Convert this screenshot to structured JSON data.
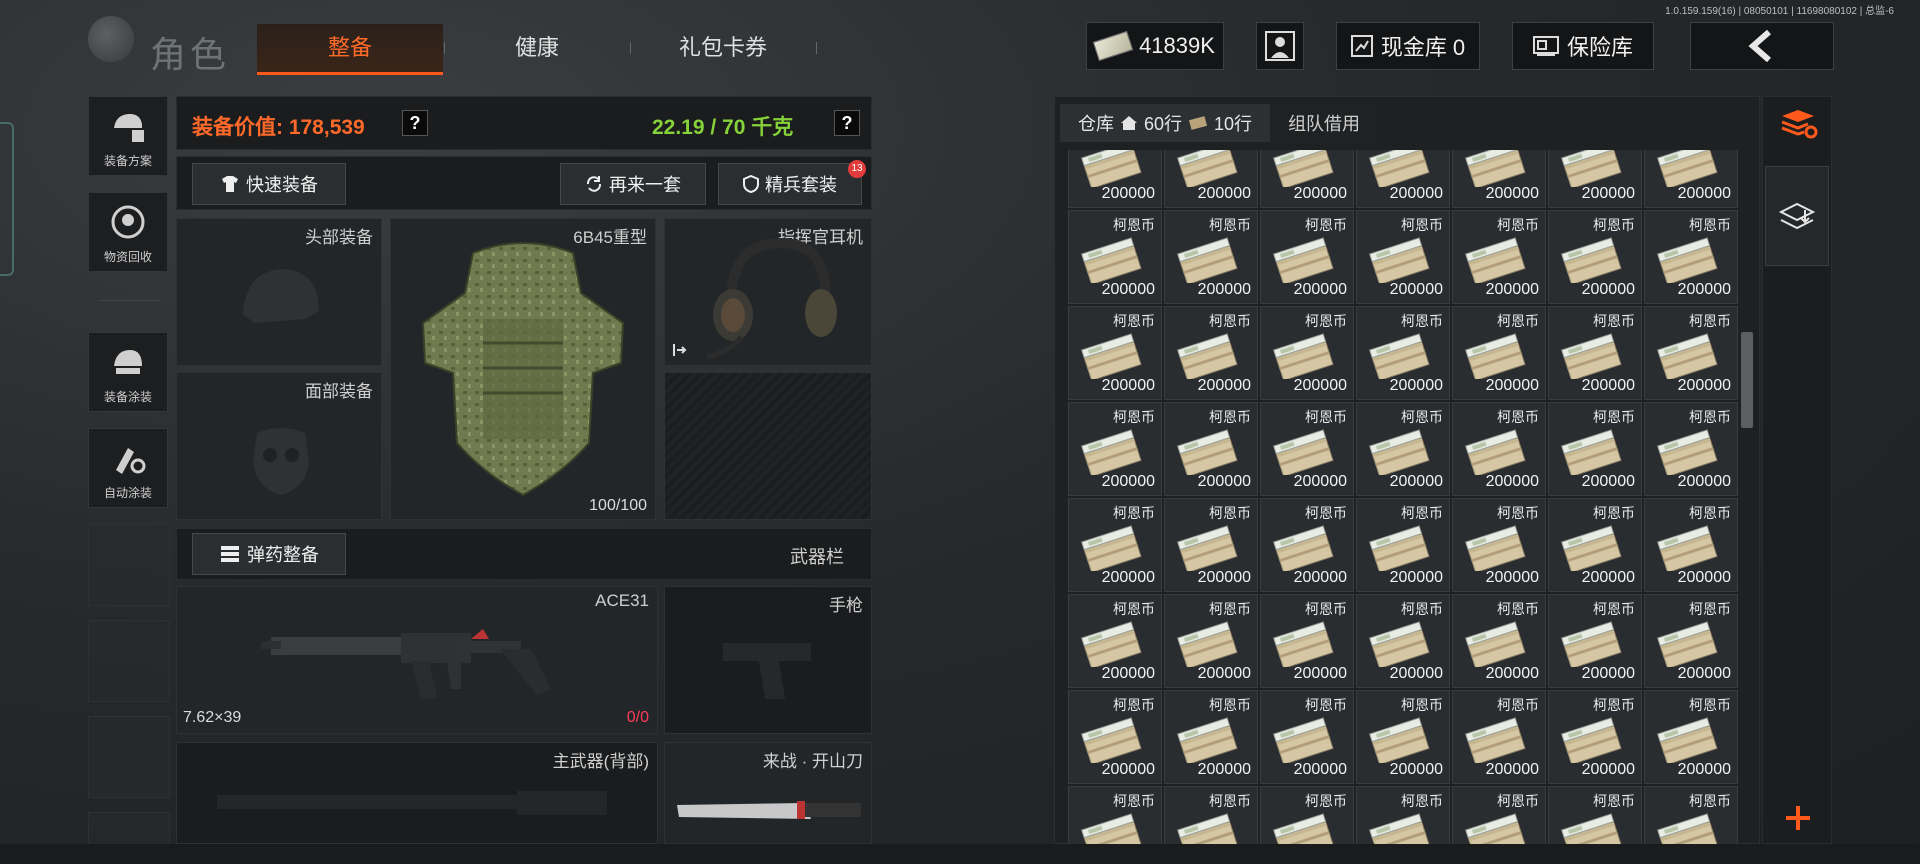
{
  "version": "1.0.159.159(16) | 08050101 | 11698080102 | 总监-6",
  "header": {
    "section_title": "角色",
    "tabs": [
      {
        "label": "整备",
        "active": true
      },
      {
        "label": "健康",
        "active": false
      },
      {
        "label": "礼包卡券",
        "active": false
      }
    ],
    "currency": "41839K",
    "cash_vault": "现金库 0",
    "safe_vault": "保险库",
    "back_icon": "chevron-left-icon"
  },
  "sidebar": {
    "items": [
      {
        "label": "装备方案",
        "icon": "loadout-plan-icon"
      },
      {
        "label": "物资回收",
        "icon": "recycle-icon"
      },
      {
        "label": "装备涂装",
        "icon": "helmet-paint-icon"
      },
      {
        "label": "自动涂装",
        "icon": "auto-paint-icon"
      }
    ]
  },
  "gear": {
    "value_label": "装备价值: 178,539",
    "weight_label": "22.19 / 70 千克",
    "help": "?",
    "quick_equip": "快速装备",
    "again": "再来一套",
    "elite": "精兵套装",
    "elite_badge": "13",
    "head_slot": "头部装备",
    "face_slot": "面部装备",
    "armor_name": "6B45重型",
    "armor_durability": "100/100",
    "headset_name": "指挥官耳机",
    "ammo_button": "弹药整备",
    "weapon_bar": "武器栏",
    "primary_weapon": "ACE31",
    "primary_caliber": "7.62×39",
    "primary_ammo": "0/0",
    "pistol_slot": "手枪",
    "back_weapon_slot": "主武器(背部)",
    "melee_name": "来战 · 开山刀"
  },
  "inventory": {
    "tabs": [
      {
        "label": "仓库"
      },
      {
        "label": "60行"
      },
      {
        "label": "10行"
      },
      {
        "label": "组队借用"
      }
    ],
    "item_name": "柯恩币",
    "item_value": "200000",
    "rows": 7,
    "cols": 7
  },
  "colors": {
    "accent": "#ff5a1c",
    "weight_green": "#86d23a",
    "badge_red": "#e23b3b"
  }
}
